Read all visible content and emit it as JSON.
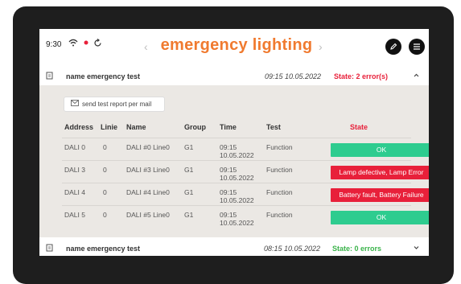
{
  "status_bar": {
    "time": "9:30",
    "icons": [
      "wifi-icon",
      "record-dot-icon",
      "sync-icon"
    ]
  },
  "header": {
    "title": "emergency lighting",
    "prev_icon": "chevron-left-icon",
    "next_icon": "chevron-right-icon",
    "edit_icon": "pencil-icon",
    "menu_icon": "hamburger-menu-icon"
  },
  "colors": {
    "accent": "#f07a2f",
    "error": "#e8203a",
    "ok": "#2ecc8f",
    "ok_text": "#3ab34a",
    "bezel": "#1e1e1e"
  },
  "tests": [
    {
      "name": "name emergency test",
      "date": "09:15 10.05.2022",
      "state": "State: 2 error(s)",
      "expanded": true,
      "send_report_label": "send test report per mail",
      "columns": [
        "Address",
        "Linie",
        "Name",
        "Group",
        "Time",
        "Test",
        "State"
      ],
      "rows": [
        {
          "address": "DALI 0",
          "linie": "0",
          "name": "DALI #0 Line0",
          "group": "G1",
          "time_1": "09:15",
          "time_2": "10.05.2022",
          "test": "Function",
          "state": "OK",
          "status": "ok"
        },
        {
          "address": "DALI 3",
          "linie": "0",
          "name": "DALI #3 Line0",
          "group": "G1",
          "time_1": "09:15",
          "time_2": "10.05.2022",
          "test": "Function",
          "state": "Lamp defective, Lamp Error",
          "status": "error"
        },
        {
          "address": "DALI 4",
          "linie": "0",
          "name": "DALI #4 Line0",
          "group": "G1",
          "time_1": "09:15",
          "time_2": "10.05.2022",
          "test": "Function",
          "state": "Battery fault, Battery Failure",
          "status": "error"
        },
        {
          "address": "DALI 5",
          "linie": "0",
          "name": "DALI #5 Line0",
          "group": "G1",
          "time_1": "09:15",
          "time_2": "10.05.2022",
          "test": "Function",
          "state": "OK",
          "status": "ok"
        }
      ]
    },
    {
      "name": "name emergency test",
      "date": "08:15 10.05.2022",
      "state": "State: 0 errors",
      "expanded": false
    }
  ]
}
